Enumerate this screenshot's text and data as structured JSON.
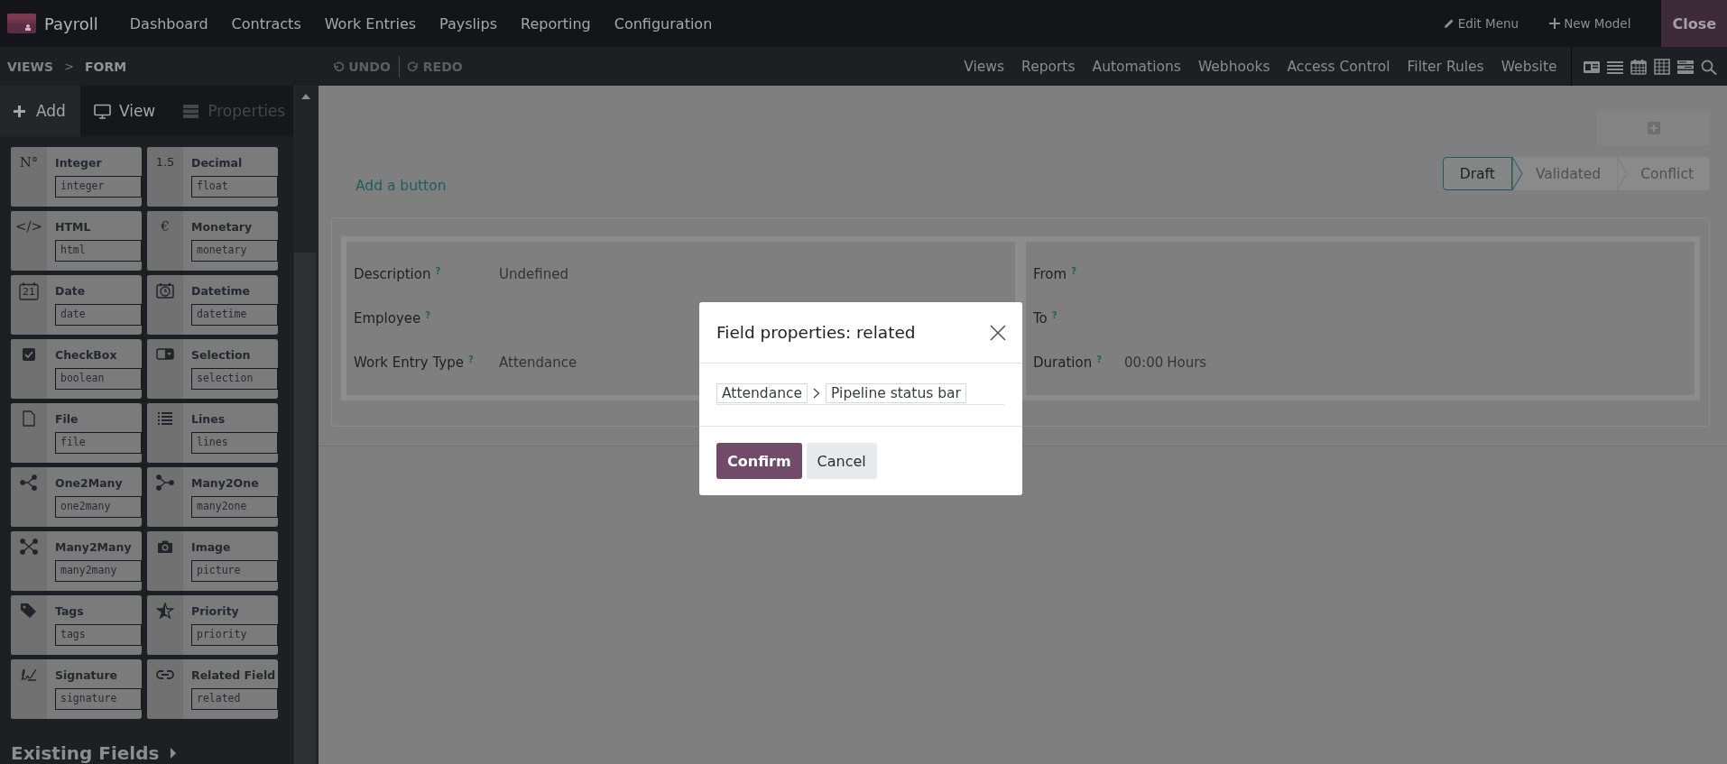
{
  "app": {
    "name": "Payroll",
    "menu": [
      "Dashboard",
      "Contracts",
      "Work Entries",
      "Payslips",
      "Reporting",
      "Configuration"
    ],
    "actions": [
      {
        "label": "Edit Menu",
        "kind": "pencil"
      },
      {
        "label": "New Model",
        "kind": "plus"
      }
    ],
    "close": "Close"
  },
  "toolbar": {
    "breadcrumb": [
      {
        "label": "VIEWS"
      },
      {
        "label": "FORM"
      }
    ],
    "breadcrumb_separator": ">",
    "undo": {
      "label": "UNDO",
      "disabled": true
    },
    "redo": {
      "label": "REDO",
      "disabled": true
    },
    "links": [
      "Views",
      "Reports",
      "Automations",
      "Webhooks",
      "Access Control",
      "Filter Rules",
      "Website"
    ],
    "view_types": [
      {
        "kind": "form"
      },
      {
        "kind": "list"
      },
      {
        "kind": "calendar"
      },
      {
        "kind": "pivot"
      },
      {
        "kind": "kanban"
      },
      {
        "kind": "search"
      }
    ]
  },
  "sidebar": {
    "tabs": [
      {
        "label": "Add",
        "kind": "plus",
        "selected": true,
        "disabled": false
      },
      {
        "label": "View",
        "kind": "monitor",
        "selected": false,
        "disabled": false
      },
      {
        "label": "Properties",
        "kind": "stack",
        "selected": false,
        "disabled": true
      }
    ],
    "field_types": [
      {
        "label": "Integer",
        "type": "integer",
        "kind": "glyph",
        "glyph": "N°"
      },
      {
        "label": "Decimal",
        "type": "float",
        "kind": "glyph",
        "glyph": "1.5"
      },
      {
        "label": "HTML",
        "type": "html",
        "kind": "glyph",
        "glyph": "</>"
      },
      {
        "label": "Monetary",
        "type": "monetary",
        "kind": "glyph",
        "glyph": "€"
      },
      {
        "label": "Date",
        "type": "date",
        "kind": "calendar",
        "glyph": "21"
      },
      {
        "label": "Datetime",
        "type": "datetime",
        "kind": "clock"
      },
      {
        "label": "CheckBox",
        "type": "boolean",
        "kind": "checkbox"
      },
      {
        "label": "Selection",
        "type": "selection",
        "kind": "select"
      },
      {
        "label": "File",
        "type": "file",
        "kind": "file"
      },
      {
        "label": "Lines",
        "type": "lines",
        "kind": "lines"
      },
      {
        "label": "One2Many",
        "type": "one2many",
        "kind": "one2many"
      },
      {
        "label": "Many2One",
        "type": "many2one",
        "kind": "many2one"
      },
      {
        "label": "Many2Many",
        "type": "many2many",
        "kind": "many2many"
      },
      {
        "label": "Image",
        "type": "picture",
        "kind": "camera"
      },
      {
        "label": "Tags",
        "type": "tags",
        "kind": "tag"
      },
      {
        "label": "Priority",
        "type": "priority",
        "kind": "star"
      },
      {
        "label": "Signature",
        "type": "signature",
        "kind": "signature"
      },
      {
        "label": "Related Field",
        "type": "related",
        "kind": "link"
      }
    ],
    "existing_fields": "Existing Fields"
  },
  "form": {
    "add_button": "Add a button",
    "statusbar": [
      {
        "label": "Draft",
        "selected": true
      },
      {
        "label": "Validated",
        "selected": false
      },
      {
        "label": "Conflict",
        "selected": false
      }
    ],
    "left_fields": [
      {
        "label": "Description",
        "help": "?",
        "value": "Undefined"
      },
      {
        "label": "Employee",
        "help": "?"
      },
      {
        "label": "Work Entry Type",
        "help": "?",
        "value": "Attendance"
      }
    ],
    "right_fields": [
      {
        "label": "From",
        "help": "?"
      },
      {
        "label": "To",
        "help": "?"
      },
      {
        "label": "Duration",
        "help": "?",
        "value": "00:00",
        "unit": "Hours"
      }
    ]
  },
  "dialog": {
    "title": "Field properties: related",
    "path": [
      "Attendance",
      "Pipeline status bar"
    ],
    "buttons": [
      {
        "label": "Confirm",
        "kind": "primary"
      },
      {
        "label": "Cancel",
        "kind": "secondary"
      }
    ]
  }
}
